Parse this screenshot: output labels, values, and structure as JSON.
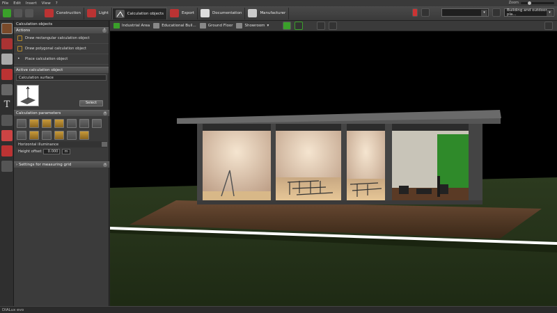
{
  "menu": {
    "items": [
      "File",
      "Edit",
      "Insert",
      "View",
      "?"
    ],
    "zoom_label": "Zoom"
  },
  "tabs": [
    {
      "label": "Construction",
      "icon": "construction-icon",
      "active": false
    },
    {
      "label": "Light",
      "icon": "light-icon",
      "active": false
    },
    {
      "label": "Calculation objects",
      "icon": "calculation-objects-icon",
      "active": true
    },
    {
      "label": "Export",
      "icon": "export-icon",
      "active": false
    },
    {
      "label": "Documentation",
      "icon": "documentation-icon",
      "active": false
    },
    {
      "label": "Manufacturer",
      "icon": "manufacturer-icon",
      "active": false
    }
  ],
  "toolbar_right": {
    "dropdown1_value": "",
    "mode_value": "Building and outdoor pla..."
  },
  "panel": {
    "title": "Calculation objects",
    "actions_header": "Actions",
    "actions": [
      "Draw rectangular calculation object",
      "Draw polygonal calculation object",
      "Place calculation object"
    ],
    "active_header": "Active calculation object",
    "active_field": "Calculation surface",
    "select_button": "Select",
    "params_header": "Calculation parameters",
    "illuminance_label": "Horizontal illuminance",
    "height_label": "Height offset",
    "height_value": "0.000",
    "height_unit": "m",
    "grid_header": "Settings for measuring grid"
  },
  "viewbar": {
    "crumbs": [
      "Industrial Area",
      "Educational Buil...",
      "Ground Floor",
      "Showroom"
    ]
  },
  "status": {
    "app_name": "DIALux evo"
  },
  "colors": {
    "accent": "#c89a3a",
    "green": "#3aa02a",
    "active_tab": "#262626"
  }
}
